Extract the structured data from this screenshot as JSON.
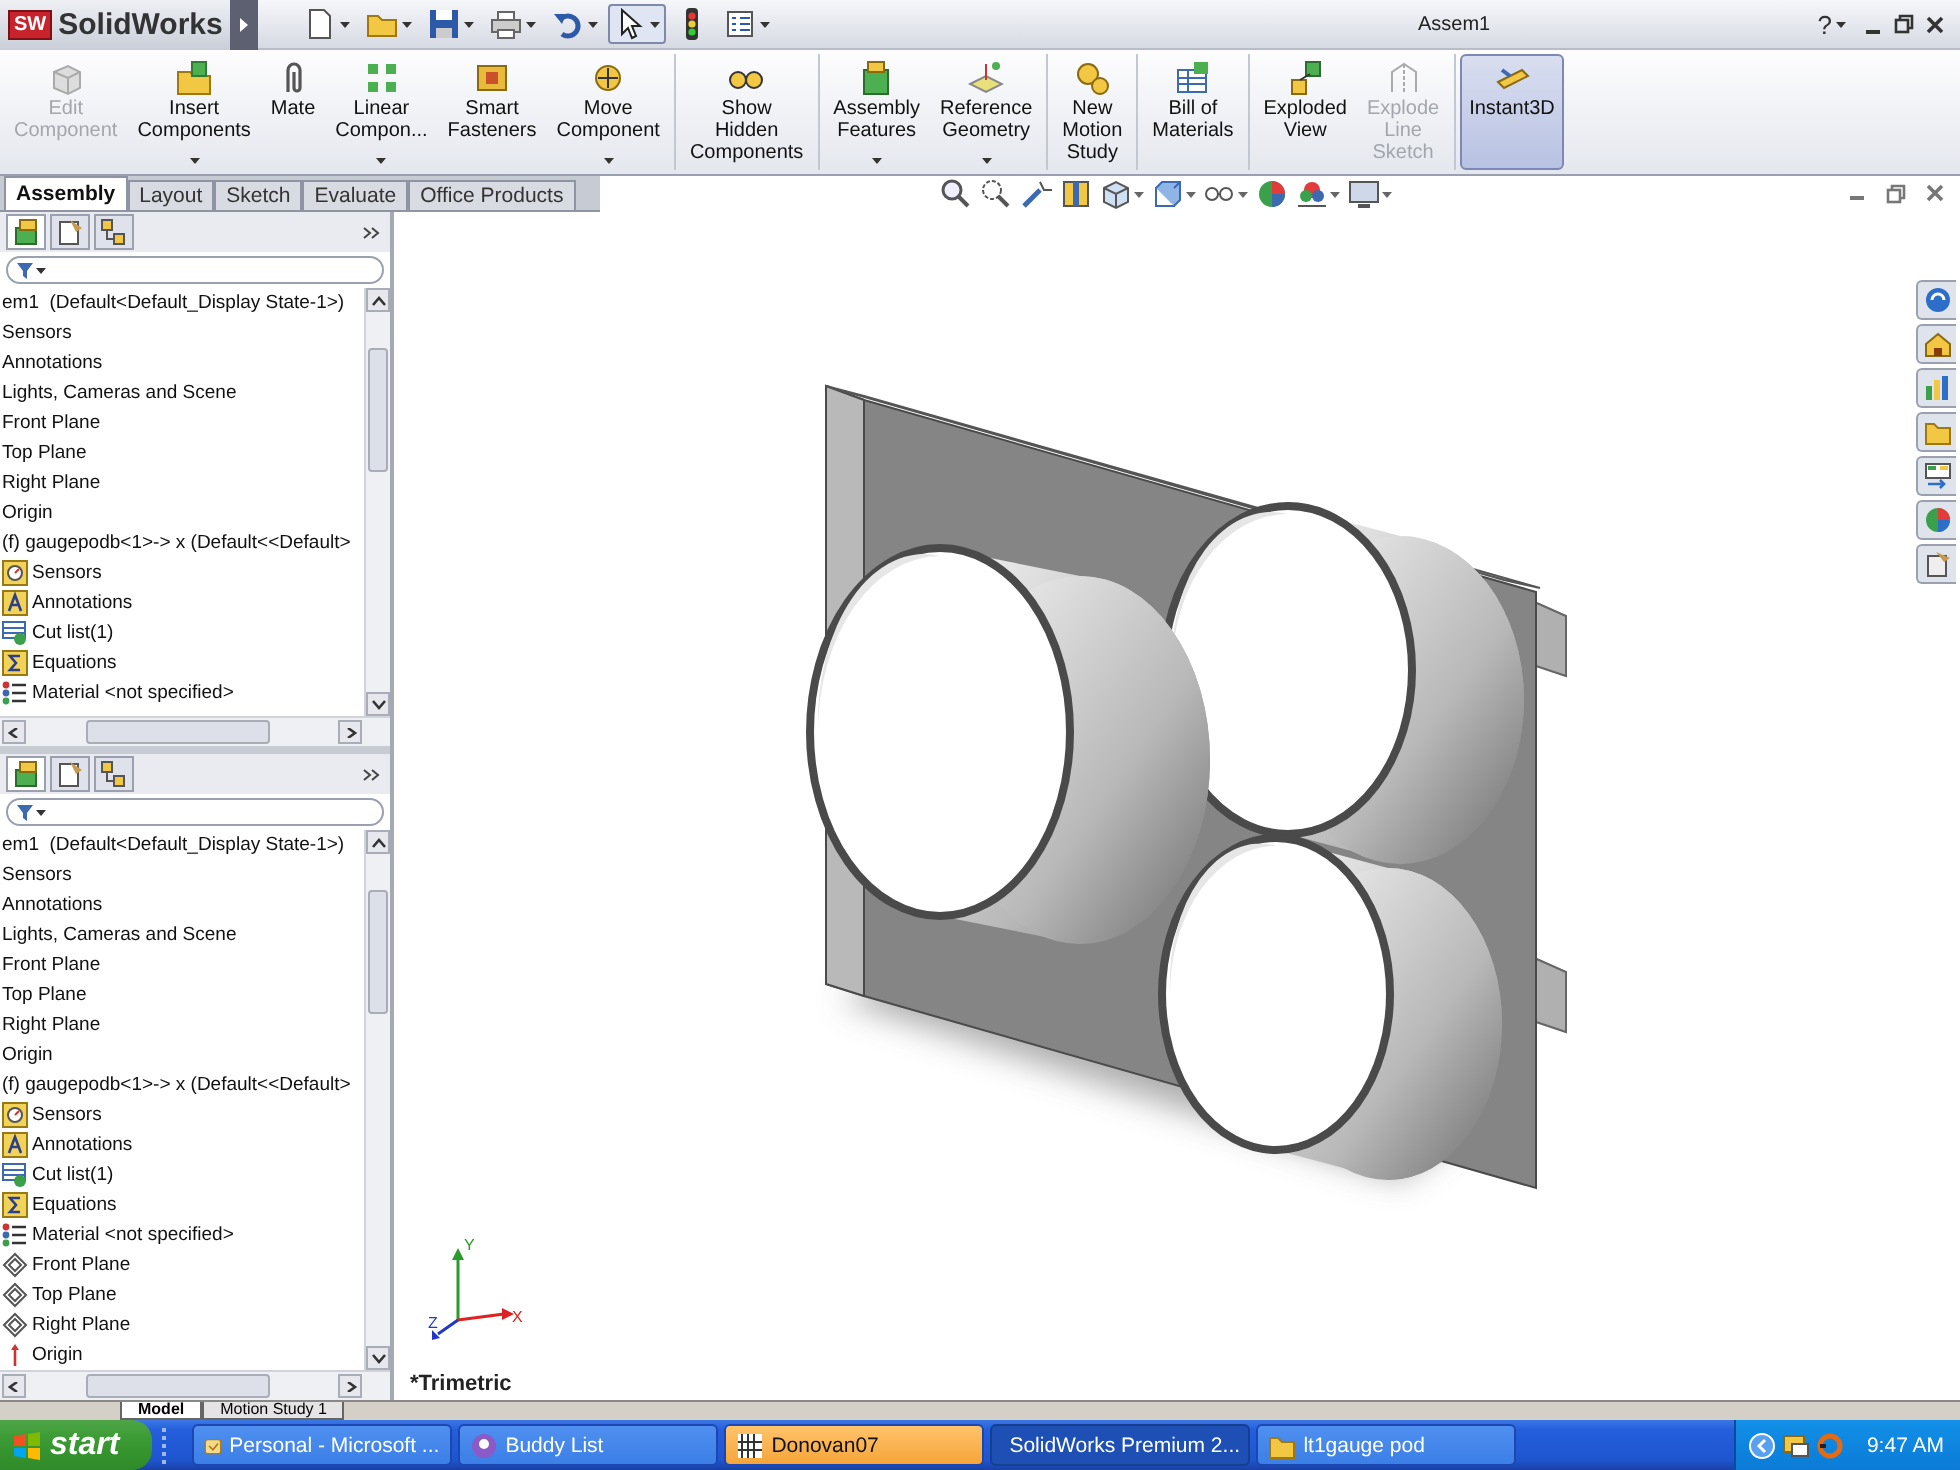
{
  "title_bar": {
    "logo_mark": "SW",
    "app_name": "SolidWorks",
    "document_title": "Assem1",
    "help": "?"
  },
  "quick_access": [
    {
      "pressed": false
    },
    {
      "pressed": false
    },
    {
      "pressed": false
    },
    {
      "pressed": false
    },
    {
      "pressed": false
    },
    {
      "pressed": true
    },
    {
      "pressed": false
    },
    {
      "pressed": false
    }
  ],
  "command_manager": {
    "groups": [
      [
        {
          "label": "Edit\nComponent",
          "disabled": true,
          "selected": false,
          "dropdown": false
        },
        {
          "label": "Insert\nComponents",
          "disabled": false,
          "selected": false,
          "dropdown": true
        },
        {
          "label": "Mate",
          "disabled": false,
          "selected": false,
          "dropdown": false
        },
        {
          "label": "Linear\nCompon...",
          "disabled": false,
          "selected": false,
          "dropdown": true
        },
        {
          "label": "Smart\nFasteners",
          "disabled": false,
          "selected": false,
          "dropdown": false
        },
        {
          "label": "Move\nComponent",
          "disabled": false,
          "selected": false,
          "dropdown": true
        }
      ],
      [
        {
          "label": "Show\nHidden\nComponents",
          "disabled": false,
          "selected": false,
          "dropdown": false
        }
      ],
      [
        {
          "label": "Assembly\nFeatures",
          "disabled": false,
          "selected": false,
          "dropdown": true
        },
        {
          "label": "Reference\nGeometry",
          "disabled": false,
          "selected": false,
          "dropdown": true
        }
      ],
      [
        {
          "label": "New\nMotion\nStudy",
          "disabled": false,
          "selected": false,
          "dropdown": false
        }
      ],
      [
        {
          "label": "Bill of\nMaterials",
          "disabled": false,
          "selected": false,
          "dropdown": false
        }
      ],
      [
        {
          "label": "Exploded\nView",
          "disabled": false,
          "selected": false,
          "dropdown": false
        },
        {
          "label": "Explode\nLine\nSketch",
          "disabled": true,
          "selected": false,
          "dropdown": false
        }
      ],
      [
        {
          "label": "Instant3D",
          "disabled": false,
          "selected": true,
          "dropdown": false
        }
      ]
    ]
  },
  "tabs": [
    {
      "label": "Assembly",
      "selected": true
    },
    {
      "label": "Layout",
      "selected": false
    },
    {
      "label": "Sketch",
      "selected": false
    },
    {
      "label": "Evaluate",
      "selected": false
    },
    {
      "label": "Office Products",
      "selected": false
    }
  ],
  "feature_manager_panes": [
    {
      "tree": [
        {
          "label": "em1  (Default<Default_Display State-1>)",
          "children": [
            {
              "label": "Sensors"
            },
            {
              "label": "Annotations"
            },
            {
              "label": "Lights, Cameras and Scene"
            },
            {
              "label": "Front Plane"
            },
            {
              "label": "Top Plane"
            },
            {
              "label": "Right Plane"
            },
            {
              "label": "Origin"
            },
            {
              "label": "(f) gaugepodb<1>-> x (Default<<Default>",
              "children": [
                {
                  "label": "Sensors",
                  "kind": "sensors"
                },
                {
                  "label": "Annotations",
                  "kind": "annotations"
                },
                {
                  "label": "Cut list(1)",
                  "kind": "cutlist"
                },
                {
                  "label": "Equations",
                  "kind": "equations"
                },
                {
                  "label": "Material <not specified>",
                  "kind": "material"
                }
              ]
            }
          ]
        }
      ]
    },
    {
      "tree": [
        {
          "label": "em1  (Default<Default_Display State-1>)",
          "children": [
            {
              "label": "Sensors"
            },
            {
              "label": "Annotations"
            },
            {
              "label": "Lights, Cameras and Scene"
            },
            {
              "label": "Front Plane"
            },
            {
              "label": "Top Plane"
            },
            {
              "label": "Right Plane"
            },
            {
              "label": "Origin"
            },
            {
              "label": "(f) gaugepodb<1>-> x (Default<<Default>",
              "children": [
                {
                  "label": "Sensors",
                  "kind": "sensors"
                },
                {
                  "label": "Annotations",
                  "kind": "annotations"
                },
                {
                  "label": "Cut list(1)",
                  "kind": "cutlist"
                },
                {
                  "label": "Equations",
                  "kind": "equations"
                },
                {
                  "label": "Material <not specified>",
                  "kind": "material"
                },
                {
                  "label": "Front Plane",
                  "kind": "plane"
                },
                {
                  "label": "Top Plane",
                  "kind": "plane"
                },
                {
                  "label": "Right Plane",
                  "kind": "plane"
                },
                {
                  "label": "Origin",
                  "kind": "origin"
                }
              ]
            }
          ]
        }
      ]
    }
  ],
  "bottom_tabs": [
    {
      "label": "Model",
      "selected": true
    },
    {
      "label": "Motion Study 1",
      "selected": false
    }
  ],
  "graphics": {
    "view_name": "*Trimetric",
    "triad": [
      "Y",
      "X",
      "Z"
    ]
  },
  "taskbar": {
    "start": "start",
    "tasks": [
      {
        "label": "Personal - Microsoft ...",
        "selected": false,
        "flashing": false
      },
      {
        "label": "Buddy List",
        "selected": false,
        "flashing": false
      },
      {
        "label": "Donovan07",
        "selected": false,
        "flashing": true
      },
      {
        "label": "SolidWorks Premium 2...",
        "selected": true,
        "flashing": false
      },
      {
        "label": "lt1gauge pod",
        "selected": false,
        "flashing": false
      }
    ],
    "clock": "9:47 AM"
  }
}
